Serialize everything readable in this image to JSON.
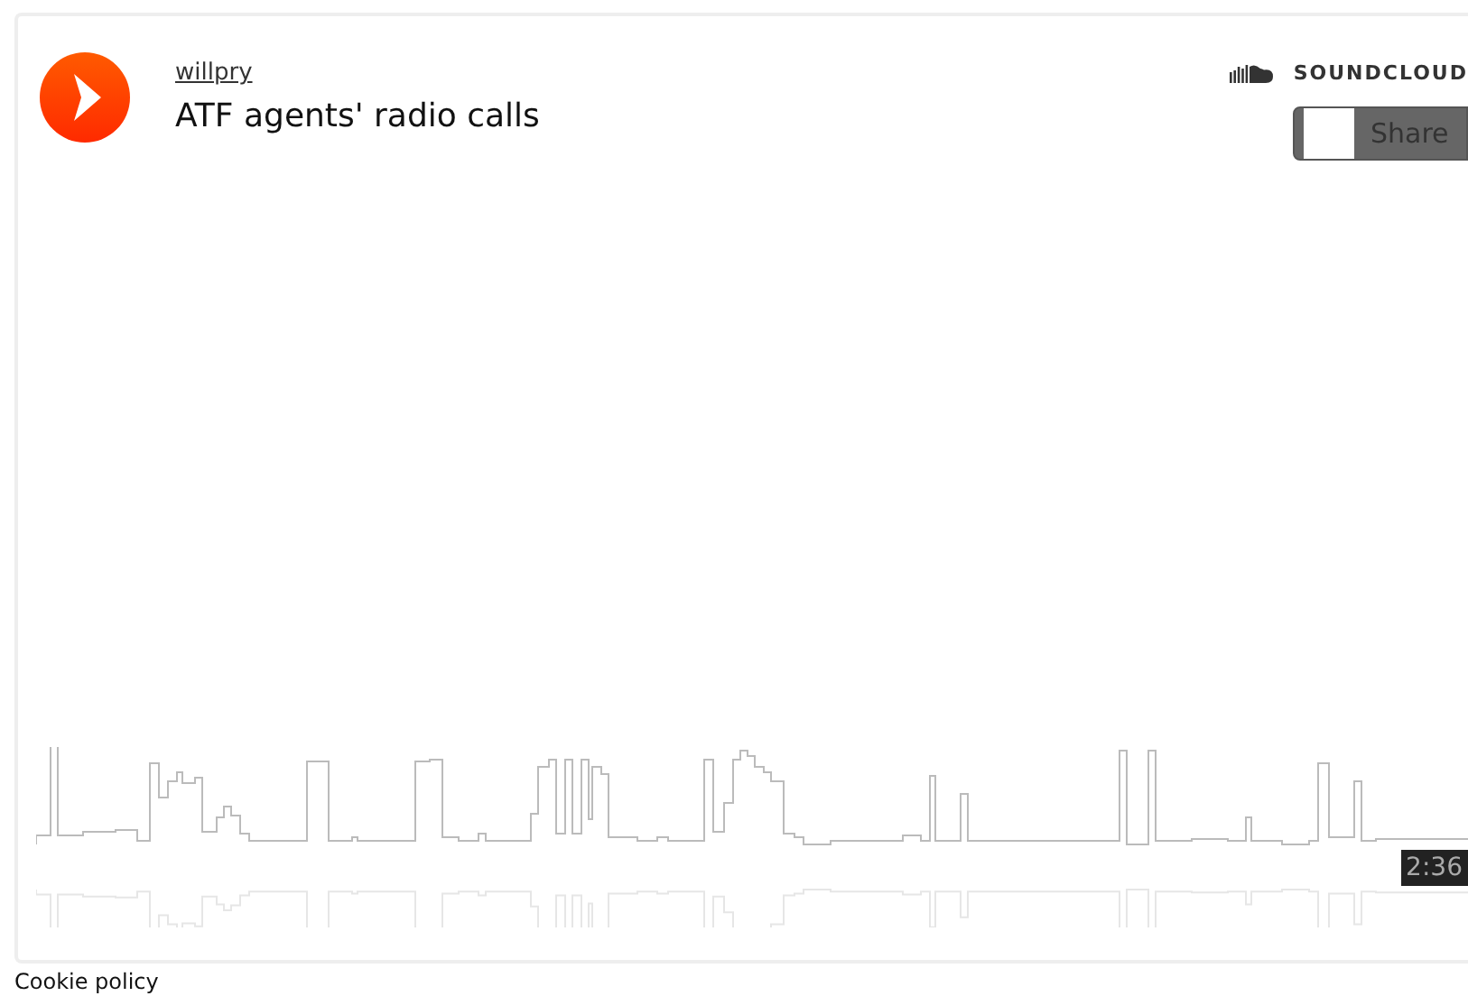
{
  "track": {
    "user": "willpry",
    "title": "ATF agents' radio calls"
  },
  "brand": {
    "name": "SOUNDCLOUD"
  },
  "share": {
    "label": "Share"
  },
  "duration": "2:36",
  "footer": {
    "link": "Cookie policy"
  }
}
